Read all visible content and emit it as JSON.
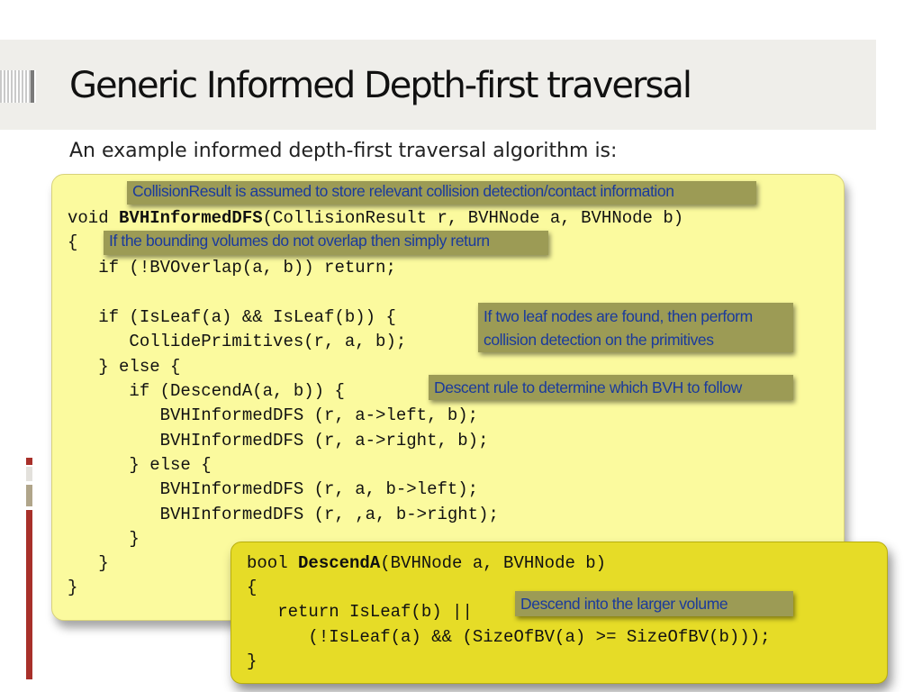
{
  "slide": {
    "title": "Generic Informed Depth-first traversal",
    "subtitle": "An example informed depth-first traversal algorithm is:"
  },
  "code_main": {
    "lines": [
      "void ",
      "BVHInformedDFS",
      "(CollisionResult r, BVHNode a, BVHNode b)",
      "{",
      "   if (!BVOverlap(a, b)) return;",
      "   if (IsLeaf(a) && IsLeaf(b)) {",
      "      CollidePrimitives(r, a, b);",
      "   } else {",
      "      if (DescendA(a, b)) {",
      "         BVHInformedDFS (r, a->left, b);",
      "         BVHInformedDFS (r, a->right, b);",
      "      } else {",
      "         BVHInformedDFS (r, a, b->left);",
      "         BVHInformedDFS (r, ,a, b->right);",
      "      }",
      "   }",
      "}"
    ]
  },
  "code_descend": {
    "sig_prefix": "bool ",
    "sig_name": "DescendA",
    "sig_suffix": "(BVHNode a, BVHNode b)",
    "open": "{",
    "ret": "   return IsLeaf(b) ||",
    "cond": "      (!IsLeaf(a) && (SizeOfBV(a) >= SizeOfBV(b)));",
    "close": "}"
  },
  "annotations": {
    "collision_result": "CollisionResult is assumed to store relevant collision detection/contact information",
    "no_overlap": "If the bounding volumes do not overlap then simply return",
    "leaf_nodes_1": "If two leaf nodes are found, then perform",
    "leaf_nodes_2": "collision detection on the primitives",
    "descent_rule": "Descent rule to determine which BVH to follow",
    "larger_volume": "Descend into the larger volume"
  },
  "colors": {
    "code_box": "#fbfa9e",
    "descend_box": "#e6dc27",
    "annotation_bg": "#9c9b55",
    "annotation_text": "#1a3a9c",
    "accent_red": "#a8302a"
  }
}
